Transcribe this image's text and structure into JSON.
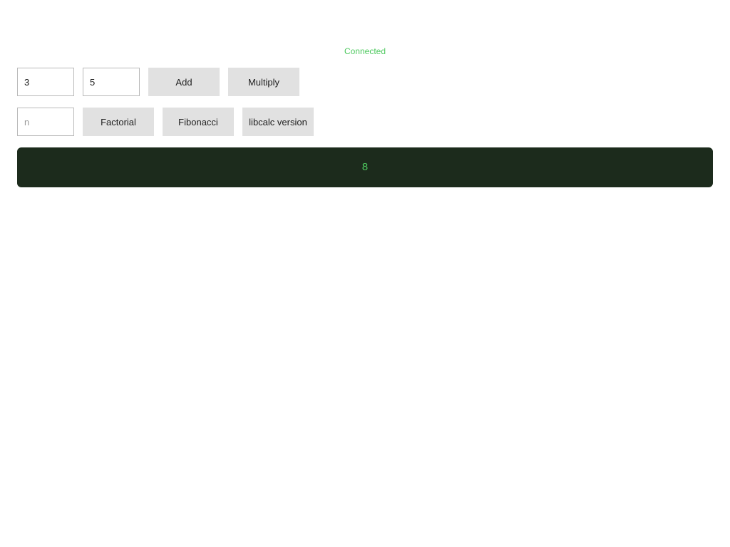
{
  "status": {
    "text": "Connected",
    "color": "#4ec95f"
  },
  "binary_ops": {
    "a_value": "3",
    "b_value": "5",
    "add_label": "Add",
    "multiply_label": "Multiply"
  },
  "unary_ops": {
    "n_value": "",
    "n_placeholder": "n",
    "factorial_label": "Factorial",
    "fibonacci_label": "Fibonacci",
    "version_label": "libcalc version"
  },
  "output": {
    "value": "8",
    "background": "#1c2b1c",
    "text_color": "#4ec95f"
  }
}
